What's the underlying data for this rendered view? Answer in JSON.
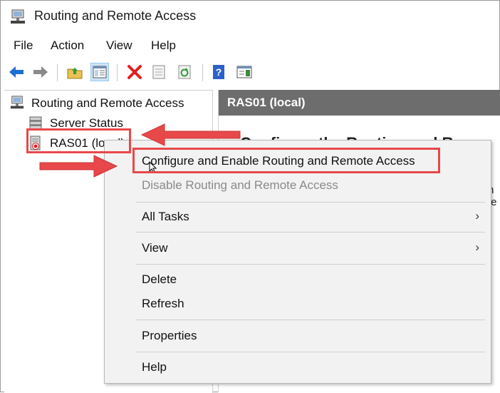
{
  "window": {
    "title": "Routing and Remote Access"
  },
  "menubar": {
    "items": [
      "File",
      "Action",
      "View",
      "Help"
    ]
  },
  "toolbar": {
    "icons": [
      "back-arrow-icon",
      "forward-arrow-icon",
      "up-folder-icon",
      "show-tree-icon",
      "delete-icon",
      "properties-icon",
      "refresh-icon",
      "help-icon",
      "console-icon"
    ],
    "colors": {
      "arrow": "#1e6fd0",
      "delete": "#e0201f",
      "help": "#2a62c9"
    }
  },
  "tree": {
    "root": "Routing and Remote Access",
    "children": [
      "Server Status",
      "RAS01 (local)"
    ]
  },
  "right_pane": {
    "header": "RAS01 (local)",
    "heading": "Configure the Routing and Rem",
    "fragments": [
      "n",
      "te"
    ]
  },
  "context_menu": {
    "items": [
      {
        "label": "Configure and Enable Routing and Remote Access",
        "enabled": true
      },
      {
        "label": "Disable Routing and Remote Access",
        "enabled": false
      },
      {
        "label": "All Tasks",
        "submenu": true
      },
      {
        "label": "View",
        "submenu": true
      },
      {
        "label": "Delete"
      },
      {
        "label": "Refresh"
      },
      {
        "label": "Properties"
      },
      {
        "label": "Help"
      }
    ],
    "submenu_glyph": "›"
  },
  "annotations": {
    "highlight_color": "#e8484a"
  }
}
